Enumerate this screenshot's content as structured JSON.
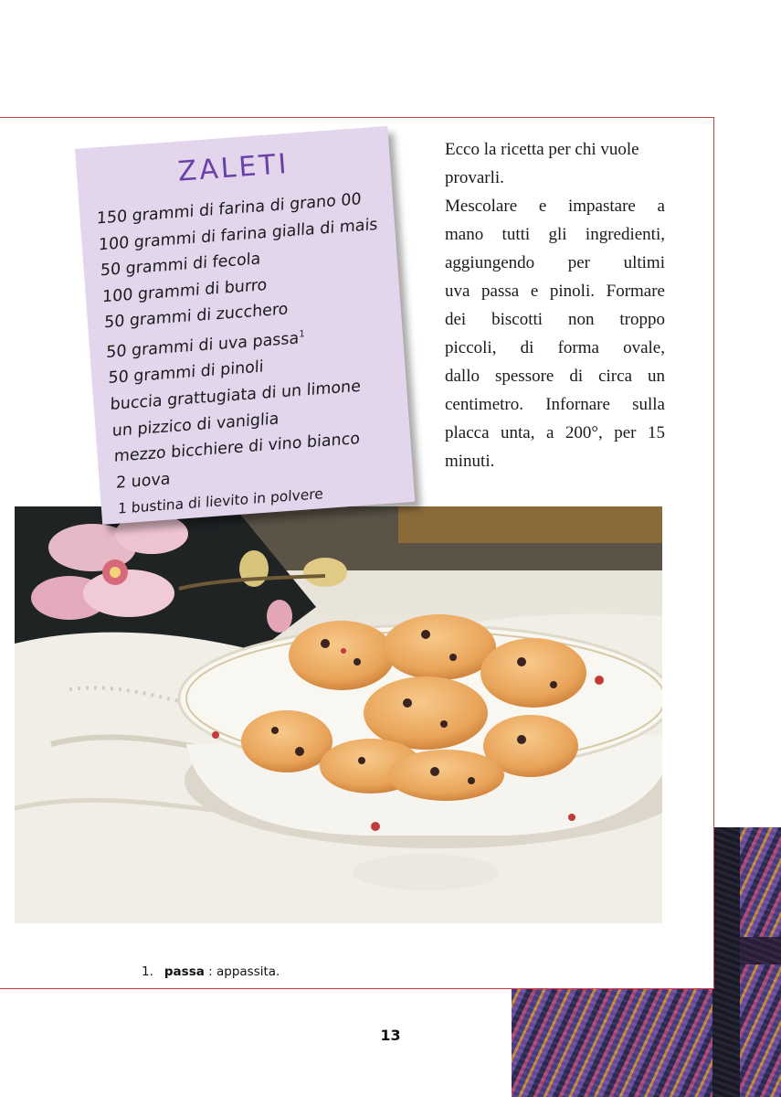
{
  "recipe_card": {
    "title": "ZALETI",
    "ingredients": [
      "150 grammi di farina di grano 00",
      "100 grammi di farina gialla di mais",
      "50 grammi di fecola",
      "100 grammi di burro",
      "50 grammi di zucchero",
      "50 grammi di uva passa",
      "50 grammi di pinoli",
      "buccia grattugiata di un limone",
      "un pizzico di vaniglia",
      "mezzo bicchiere di vino bianco",
      "2 uova",
      "1 bustina di lievito in polvere"
    ],
    "footnote_marker": "1"
  },
  "body_lines": [
    "Ecco la ricetta per chi vuole",
    "provarli.",
    "Mescolare e impastare a",
    "mano tutti gli ingredienti,",
    "aggiungendo per ultimi",
    "uva passa e pinoli. Formare",
    "dei biscotti non troppo",
    "piccoli, di forma ovale,",
    "dallo spessore di circa un",
    "centimetro. Infornare sulla",
    "placca unta, a 200°, per 15",
    "minuti."
  ],
  "footnote": {
    "number": "1.",
    "term": "passa",
    "definition": " : appassita."
  },
  "page_number": "13",
  "colors": {
    "frame_border": "#c8413b",
    "note_background": "#e2d5ec",
    "note_title": "#6a3fa8"
  }
}
